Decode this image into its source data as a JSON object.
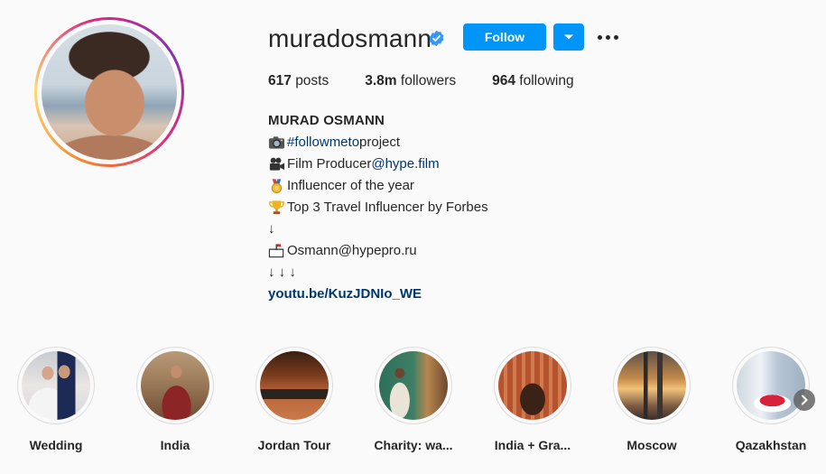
{
  "profile": {
    "username": "muradosmann",
    "follow_label": "Follow"
  },
  "stats": {
    "posts_count": "617",
    "posts_label": "posts",
    "followers_count": "3.8m",
    "followers_label": "followers",
    "following_count": "964",
    "following_label": "following"
  },
  "bio": {
    "name": "MURAD OSMANN",
    "line1_tag": "#followmeto",
    "line1_text": " project",
    "line2_text": "Film Producer ",
    "line2_mention": "@hype.film",
    "line3_text": "Influencer of the year",
    "line4_text": "Top 3 Travel Influencer by Forbes",
    "line5_text": "↓",
    "line6_text": " Osmann@hypepro.ru",
    "line7_text": "↓ ↓ ↓",
    "link": "youtu.be/KuzJDNIo_WE"
  },
  "highlights": [
    {
      "label": "Wedding"
    },
    {
      "label": "India"
    },
    {
      "label": "Jordan Tour"
    },
    {
      "label": "Charity: wa..."
    },
    {
      "label": "India + Gra..."
    },
    {
      "label": "Moscow"
    },
    {
      "label": "Qazakhstan"
    }
  ],
  "colors": {
    "accent": "#0095f6",
    "link": "#00376b",
    "text": "#262626",
    "background": "#fafafa"
  },
  "icons": {
    "verified": "verified-badge-icon",
    "dropdown": "chevron-down-icon",
    "more": "more-options-icon",
    "next": "chevron-right-icon"
  }
}
